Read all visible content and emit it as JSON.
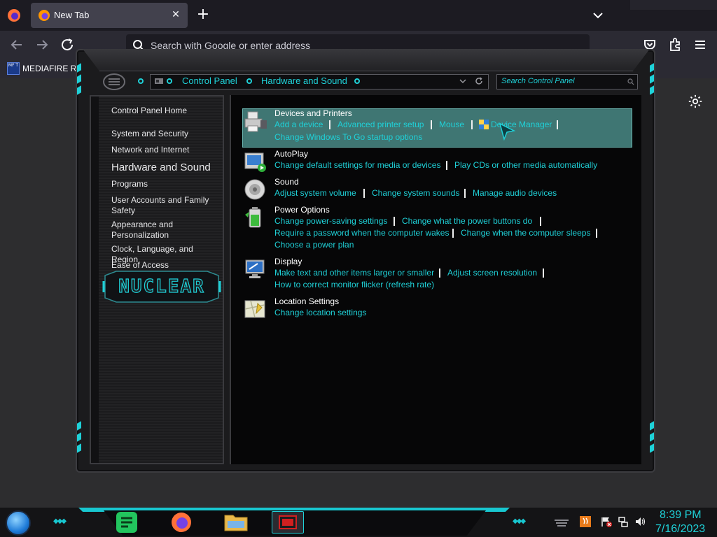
{
  "browser": {
    "tab_title": "New Tab",
    "url_placeholder": "Search with Google or enter address",
    "bookmark_label": "MEDIAFIRE RO",
    "bookmark_icon_text": "MF T"
  },
  "control_panel": {
    "breadcrumbs": [
      "Control Panel",
      "Hardware and Sound"
    ],
    "search_placeholder": "Search Control Panel",
    "left_nav": [
      "Control Panel Home",
      "System and Security",
      "Network and Internet",
      "Hardware and Sound",
      "Programs",
      "User Accounts and Family Safety",
      "Appearance and Personalization",
      "Clock, Language, and Region",
      "Ease of Access"
    ],
    "logo_text": "NUCLEAR",
    "categories": [
      {
        "title": "Devices and Printers",
        "links": [
          "Add a device",
          "Advanced printer setup",
          "Mouse",
          "Device Manager",
          "Change Windows To Go startup options"
        ]
      },
      {
        "title": "AutoPlay",
        "links": [
          "Change default settings for media or devices",
          "Play CDs or other media automatically"
        ]
      },
      {
        "title": "Sound",
        "links": [
          "Adjust system volume",
          "Change system sounds",
          "Manage audio devices"
        ]
      },
      {
        "title": "Power Options",
        "links": [
          "Change power-saving settings",
          "Change what the power buttons do",
          "Require a password when the computer wakes",
          "Change when the computer sleeps",
          "Choose a power plan"
        ]
      },
      {
        "title": "Display",
        "links": [
          "Make text and other items larger or smaller",
          "Adjust screen resolution",
          "How to correct monitor flicker (refresh rate)"
        ]
      },
      {
        "title": "Location Settings",
        "links": [
          "Change location settings"
        ]
      }
    ]
  },
  "taskbar": {
    "time": "8:39 PM",
    "date": "7/16/2023"
  },
  "colors": {
    "accent": "#1fd1d8",
    "highlight": "#4a8a86",
    "browser_bg": "#2b2a33"
  }
}
